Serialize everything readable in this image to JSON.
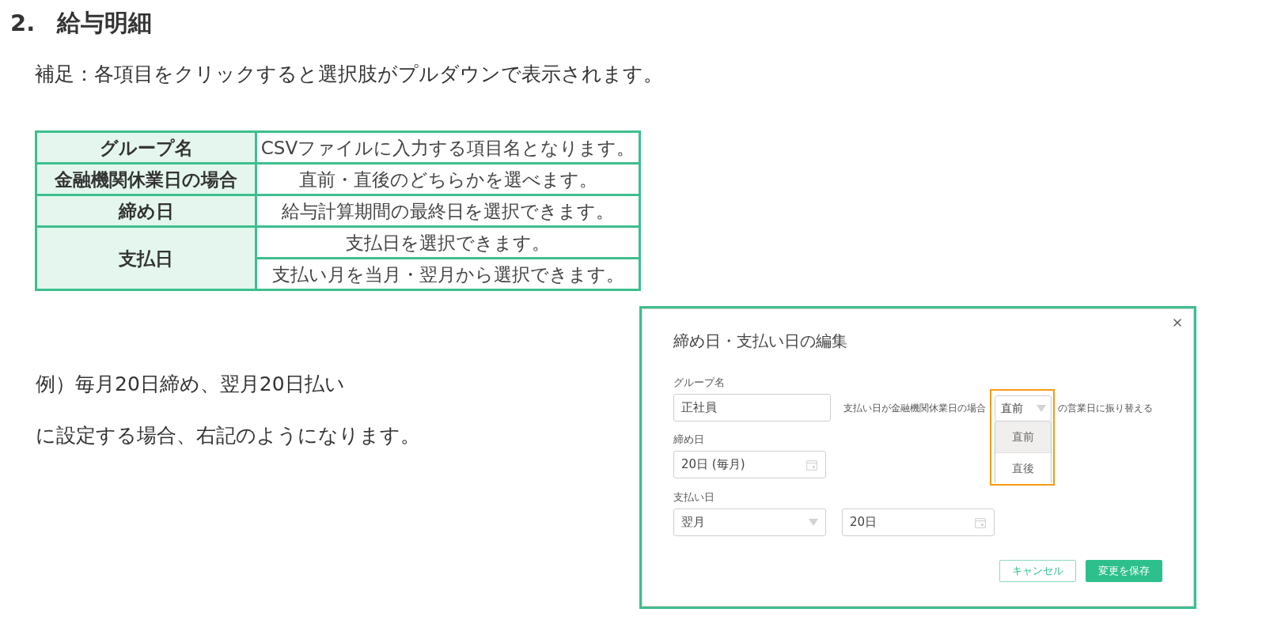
{
  "heading": {
    "number": "2.",
    "title": "給与明細"
  },
  "note": "補足：各項目をクリックすると選択肢がプルダウンで表示されます。",
  "table": {
    "rows": [
      {
        "header": "グループ名",
        "descriptions": [
          "CSVファイルに入力する項目名となります。"
        ]
      },
      {
        "header": "金融機関休業日の場合",
        "descriptions": [
          "直前・直後のどちらかを選べます。"
        ]
      },
      {
        "header": "締め日",
        "descriptions": [
          "給与計算期間の最終日を選択できます。"
        ]
      },
      {
        "header": "支払日",
        "descriptions": [
          "支払日を選択できます。",
          "支払い月を当月・翌月から選択できます。"
        ]
      }
    ]
  },
  "example": [
    "例）毎月20日締め、翌月20日払い",
    "に設定する場合、右記のようになります。"
  ],
  "dialog": {
    "title": "締め日・支払い日の編集",
    "group_name": {
      "label": "グループ名",
      "value": "正社員"
    },
    "holiday_shift": {
      "prefix": "支払い日が金融機関休業日の場合",
      "value": "直前",
      "suffix": "の営業日に振り替える",
      "expanded": true,
      "highlighted": true,
      "options": [
        {
          "label": "直前",
          "selected": true
        },
        {
          "label": "直後",
          "selected": false
        }
      ]
    },
    "closing_day": {
      "label": "締め日",
      "value": "20日 (毎月)"
    },
    "pay_day": {
      "label": "支払い日",
      "month": "翌月",
      "day": "20日"
    },
    "buttons": [
      {
        "label": "キャンセル",
        "kind": "secondary"
      },
      {
        "label": "変更を保存",
        "kind": "primary"
      }
    ]
  }
}
